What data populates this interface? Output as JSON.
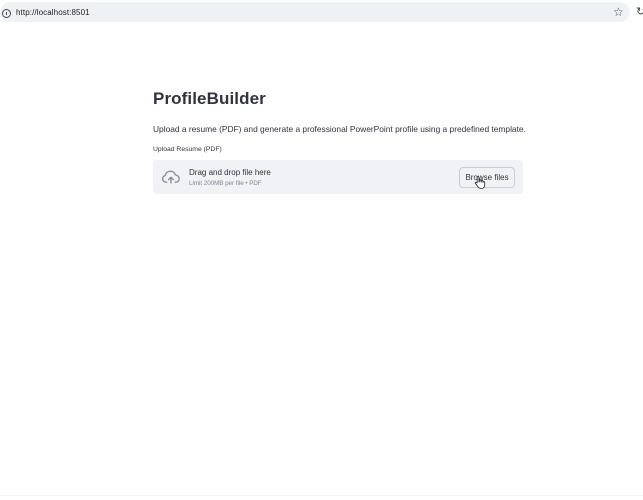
{
  "browser": {
    "url": "http://localhost:8501",
    "icons": [
      "info-icon",
      "star-icon",
      "reload-icon"
    ]
  },
  "app": {
    "title": "ProfileBuilder",
    "description": "Upload a resume (PDF) and generate a professional PowerPoint profile using a predefined template."
  },
  "uploader": {
    "label": "Upload Resume (PDF)",
    "drop_text": "Drag and drop file here",
    "limit_text": "Limit 200MB per file • PDF",
    "browse_label": "Browse files",
    "icon": "cloud-upload-icon"
  },
  "colors": {
    "text": "#31333f",
    "dropzone_bg": "#f0f2f6",
    "url_bar_bg": "#eef1f6",
    "muted": "#808495"
  }
}
